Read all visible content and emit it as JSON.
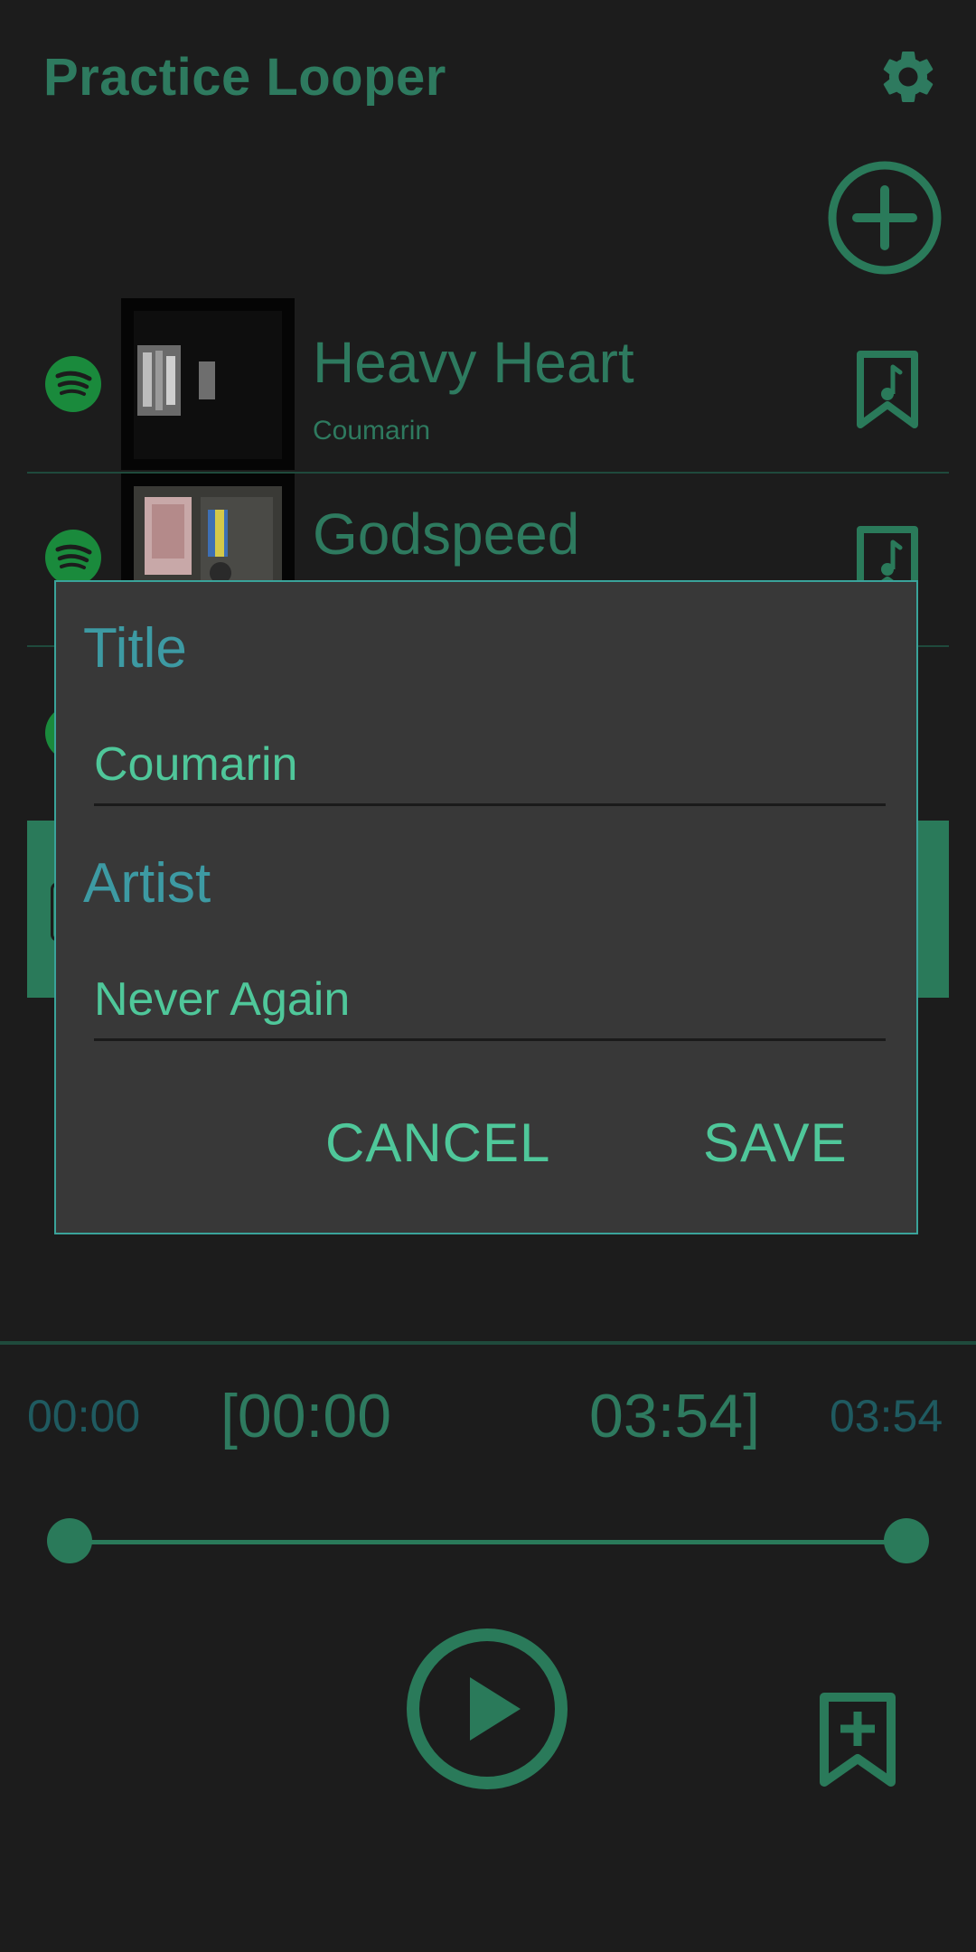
{
  "app": {
    "title": "Practice Looper"
  },
  "colors": {
    "background": "#1c1c1c",
    "accent_dim": "#2e7a5f",
    "dialog_bg": "#383838",
    "dialog_border": "#3aa39a",
    "dialog_label": "#3d9aa3",
    "dialog_text": "#4fc79a",
    "spotify_green": "#1a8a3c"
  },
  "icons": {
    "settings": "gear-icon",
    "add": "plus-circle-icon",
    "source": "spotify-icon",
    "bookmarks": "bookmark-music-icon",
    "play": "play-circle-icon",
    "add_bookmark": "bookmark-plus-icon"
  },
  "songs": [
    {
      "title": "Heavy Heart",
      "artist": "Coumarin"
    },
    {
      "title": "Godspeed",
      "artist": ""
    }
  ],
  "dialog": {
    "title_label": "Title",
    "title_value": "Coumarin",
    "artist_label": "Artist",
    "artist_value": "Never Again",
    "cancel_label": "CANCEL",
    "save_label": "SAVE"
  },
  "player": {
    "position": "00:00",
    "loop_start": "[00:00",
    "loop_end": "03:54]",
    "duration": "03:54"
  }
}
